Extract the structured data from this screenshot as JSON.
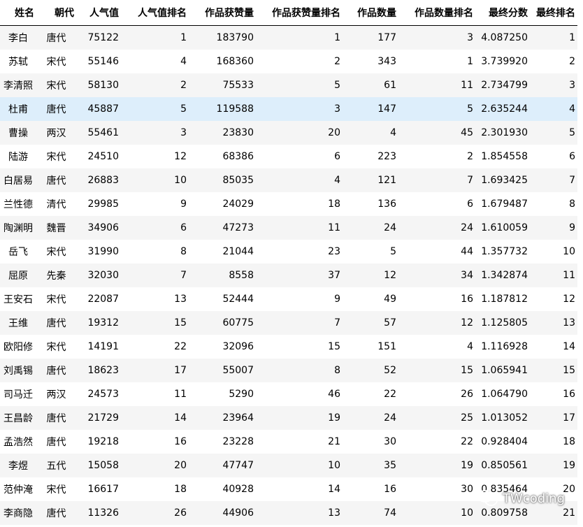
{
  "columns": [
    "姓名",
    "朝代",
    "人气值",
    "人气值排名",
    "作品获赞量",
    "作品获赞量排名",
    "作品数量",
    "作品数量排名",
    "最终分数",
    "最终排名"
  ],
  "rows": [
    [
      "李白",
      "唐代",
      "75122",
      "1",
      "183790",
      "1",
      "177",
      "3",
      "4.087250",
      "1"
    ],
    [
      "苏轼",
      "宋代",
      "55146",
      "4",
      "168360",
      "2",
      "343",
      "1",
      "3.739920",
      "2"
    ],
    [
      "李清照",
      "宋代",
      "58130",
      "2",
      "75533",
      "5",
      "61",
      "11",
      "2.734799",
      "3"
    ],
    [
      "杜甫",
      "唐代",
      "45887",
      "5",
      "119588",
      "3",
      "147",
      "5",
      "2.635244",
      "4"
    ],
    [
      "曹操",
      "两汉",
      "55461",
      "3",
      "23830",
      "20",
      "4",
      "45",
      "2.301930",
      "5"
    ],
    [
      "陆游",
      "宋代",
      "24510",
      "12",
      "68386",
      "6",
      "223",
      "2",
      "1.854558",
      "6"
    ],
    [
      "白居易",
      "唐代",
      "26883",
      "10",
      "85035",
      "4",
      "121",
      "7",
      "1.693425",
      "7"
    ],
    [
      "兰性德",
      "清代",
      "29985",
      "9",
      "24029",
      "18",
      "136",
      "6",
      "1.679487",
      "8"
    ],
    [
      "陶渊明",
      "魏晋",
      "34906",
      "6",
      "47273",
      "11",
      "24",
      "24",
      "1.610059",
      "9"
    ],
    [
      "岳飞",
      "宋代",
      "31990",
      "8",
      "21044",
      "23",
      "5",
      "44",
      "1.357732",
      "10"
    ],
    [
      "屈原",
      "先秦",
      "32030",
      "7",
      "8558",
      "37",
      "12",
      "34",
      "1.342874",
      "11"
    ],
    [
      "王安石",
      "宋代",
      "22087",
      "13",
      "52444",
      "9",
      "49",
      "16",
      "1.187812",
      "12"
    ],
    [
      "王维",
      "唐代",
      "19312",
      "15",
      "60775",
      "7",
      "57",
      "12",
      "1.125805",
      "13"
    ],
    [
      "欧阳修",
      "宋代",
      "14191",
      "22",
      "32096",
      "15",
      "151",
      "4",
      "1.116928",
      "14"
    ],
    [
      "刘禹锡",
      "唐代",
      "18623",
      "17",
      "55007",
      "8",
      "52",
      "15",
      "1.065941",
      "15"
    ],
    [
      "司马迁",
      "两汉",
      "24573",
      "11",
      "5290",
      "46",
      "22",
      "26",
      "1.064790",
      "16"
    ],
    [
      "王昌龄",
      "唐代",
      "21729",
      "14",
      "23964",
      "19",
      "24",
      "25",
      "1.013052",
      "17"
    ],
    [
      "孟浩然",
      "唐代",
      "19218",
      "16",
      "23228",
      "21",
      "30",
      "22",
      "0.928404",
      "18"
    ],
    [
      "李煜",
      "五代",
      "15058",
      "20",
      "47747",
      "10",
      "35",
      "19",
      "0.850561",
      "19"
    ],
    [
      "范仲淹",
      "宋代",
      "16617",
      "18",
      "40928",
      "14",
      "16",
      "30",
      "0.835464",
      "20"
    ],
    [
      "李商隐",
      "唐代",
      "11326",
      "26",
      "44906",
      "13",
      "74",
      "10",
      "0.809758",
      "21"
    ]
  ],
  "highlighted_row": 3,
  "watermark": {
    "text": "TWcoding",
    "icon": "wechat-icon"
  }
}
